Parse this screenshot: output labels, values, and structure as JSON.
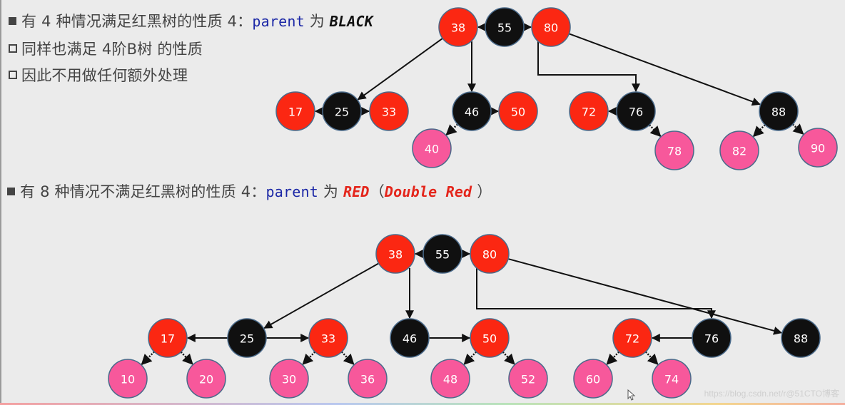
{
  "section1": {
    "heading": {
      "prefix": "有 4 种情况满足红黑树的性质 4：",
      "code": "parent",
      "middle": " 为 ",
      "emphasis": "BLACK"
    },
    "sub_bullets": [
      "同样也满足 4阶B树 的性质",
      "因此不用做任何额外处理"
    ]
  },
  "section2": {
    "heading": {
      "prefix": "有 8 种情况不满足红黑树的性质 4：",
      "code": "parent",
      "middle": " 为 ",
      "emphasis": "RED",
      "paren_open": "（",
      "emphasis2": "Double Red",
      "paren_close": "  ）"
    }
  },
  "colors": {
    "red": "#fb2712",
    "black": "#101010",
    "pink": "#f7589b",
    "node_stroke": "#4a6a8a",
    "edge": "#111111"
  },
  "diagrams": [
    {
      "id": "tree-black-parent",
      "nodes": [
        {
          "key": "38",
          "color": "red"
        },
        {
          "key": "55",
          "color": "black"
        },
        {
          "key": "80",
          "color": "red"
        },
        {
          "key": "17",
          "color": "red"
        },
        {
          "key": "25",
          "color": "black"
        },
        {
          "key": "33",
          "color": "red"
        },
        {
          "key": "46",
          "color": "black"
        },
        {
          "key": "50",
          "color": "red"
        },
        {
          "key": "72",
          "color": "red"
        },
        {
          "key": "76",
          "color": "black"
        },
        {
          "key": "88",
          "color": "black"
        },
        {
          "key": "40",
          "color": "pink"
        },
        {
          "key": "78",
          "color": "pink"
        },
        {
          "key": "82",
          "color": "pink"
        },
        {
          "key": "90",
          "color": "pink"
        }
      ],
      "edges": [
        {
          "from": "55",
          "to": "38",
          "style": "solid"
        },
        {
          "from": "55",
          "to": "80",
          "style": "solid"
        },
        {
          "from": "38",
          "to": "25",
          "style": "solid"
        },
        {
          "from": "38",
          "to": "46",
          "style": "solid"
        },
        {
          "from": "80",
          "to": "76",
          "style": "elbow"
        },
        {
          "from": "80",
          "to": "88",
          "style": "solid"
        },
        {
          "from": "25",
          "to": "17",
          "style": "solid"
        },
        {
          "from": "25",
          "to": "33",
          "style": "solid"
        },
        {
          "from": "46",
          "to": "50",
          "style": "solid"
        },
        {
          "from": "76",
          "to": "72",
          "style": "solid"
        },
        {
          "from": "46",
          "to": "40",
          "style": "dotted"
        },
        {
          "from": "76",
          "to": "78",
          "style": "dotted"
        },
        {
          "from": "88",
          "to": "82",
          "style": "dotted"
        },
        {
          "from": "88",
          "to": "90",
          "style": "dotted"
        }
      ]
    },
    {
      "id": "tree-red-parent",
      "nodes": [
        {
          "key": "38",
          "color": "red"
        },
        {
          "key": "55",
          "color": "black"
        },
        {
          "key": "80",
          "color": "red"
        },
        {
          "key": "17",
          "color": "red"
        },
        {
          "key": "25",
          "color": "black"
        },
        {
          "key": "33",
          "color": "red"
        },
        {
          "key": "46",
          "color": "black"
        },
        {
          "key": "50",
          "color": "red"
        },
        {
          "key": "72",
          "color": "red"
        },
        {
          "key": "76",
          "color": "black"
        },
        {
          "key": "88",
          "color": "black"
        },
        {
          "key": "10",
          "color": "pink"
        },
        {
          "key": "20",
          "color": "pink"
        },
        {
          "key": "30",
          "color": "pink"
        },
        {
          "key": "36",
          "color": "pink"
        },
        {
          "key": "48",
          "color": "pink"
        },
        {
          "key": "52",
          "color": "pink"
        },
        {
          "key": "60",
          "color": "pink"
        },
        {
          "key": "74",
          "color": "pink"
        }
      ],
      "edges": [
        {
          "from": "55",
          "to": "38",
          "style": "solid"
        },
        {
          "from": "55",
          "to": "80",
          "style": "solid"
        },
        {
          "from": "38",
          "to": "25",
          "style": "solid"
        },
        {
          "from": "38",
          "to": "46",
          "style": "solid"
        },
        {
          "from": "80",
          "to": "76",
          "style": "elbow"
        },
        {
          "from": "80",
          "to": "88",
          "style": "solid"
        },
        {
          "from": "25",
          "to": "17",
          "style": "solid"
        },
        {
          "from": "25",
          "to": "33",
          "style": "solid"
        },
        {
          "from": "46",
          "to": "50",
          "style": "solid"
        },
        {
          "from": "76",
          "to": "72",
          "style": "solid"
        },
        {
          "from": "17",
          "to": "10",
          "style": "dotted"
        },
        {
          "from": "17",
          "to": "20",
          "style": "dotted"
        },
        {
          "from": "33",
          "to": "30",
          "style": "dotted"
        },
        {
          "from": "33",
          "to": "36",
          "style": "dotted"
        },
        {
          "from": "50",
          "to": "48",
          "style": "dotted"
        },
        {
          "from": "50",
          "to": "52",
          "style": "dotted"
        },
        {
          "from": "72",
          "to": "60",
          "style": "dotted"
        },
        {
          "from": "72",
          "to": "74",
          "style": "dotted"
        }
      ]
    }
  ],
  "watermark": "https://blog.csdn.net/r@51CTO博客"
}
